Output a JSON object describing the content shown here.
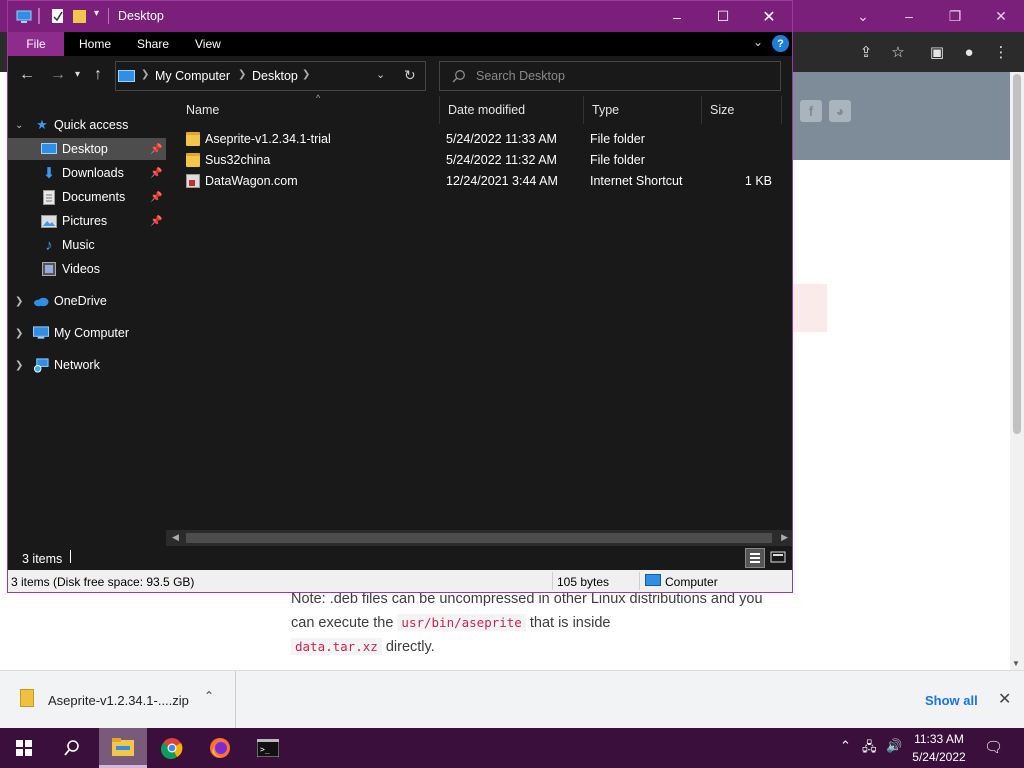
{
  "explorer": {
    "title": "Desktop",
    "ribbon": {
      "file": "File",
      "home": "Home",
      "share": "Share",
      "view": "View"
    },
    "address": {
      "root": "My Computer",
      "current": "Desktop"
    },
    "search_placeholder": "Search Desktop",
    "nav_pane": {
      "quick_access": "Quick access",
      "items": [
        {
          "label": "Desktop",
          "pinned": true,
          "selected": true
        },
        {
          "label": "Downloads",
          "pinned": true
        },
        {
          "label": "Documents",
          "pinned": true
        },
        {
          "label": "Pictures",
          "pinned": true
        },
        {
          "label": "Music"
        },
        {
          "label": "Videos"
        }
      ],
      "roots": [
        "OneDrive",
        "My Computer",
        "Network"
      ]
    },
    "columns": {
      "name": "Name",
      "date": "Date modified",
      "type": "Type",
      "size": "Size"
    },
    "files": [
      {
        "name": "Aseprite-v1.2.34.1-trial",
        "date": "5/24/2022 11:33 AM",
        "type": "File folder",
        "size": "",
        "icon": "folder-icon"
      },
      {
        "name": "Sus32china",
        "date": "5/24/2022 11:32 AM",
        "type": "File folder",
        "size": "",
        "icon": "folder-icon"
      },
      {
        "name": "DataWagon.com",
        "date": "12/24/2021 3:44 AM",
        "type": "Internet Shortcut",
        "size": "1 KB",
        "icon": "shortcut-icon"
      }
    ],
    "status": {
      "items": "3 items"
    },
    "details_bar": {
      "summary": "3 items (Disk free space: 93.5 GB)",
      "size": "105 bytes",
      "location": "Computer"
    }
  },
  "browser_page": {
    "note_part1": "Note: .deb files can be uncompressed in other Linux distributions and you can execute the",
    "note_code1": "usr/bin/aseprite",
    "note_part2": "that is inside",
    "note_code2": "data.tar.xz",
    "note_part3": "directly."
  },
  "download_bar": {
    "file": "Aseprite-v1.2.34.1-....zip",
    "show_all": "Show all"
  },
  "taskbar": {
    "time": "11:33 AM",
    "date": "5/24/2022"
  },
  "colors": {
    "accent": "#7a1f7a",
    "explorer_bg": "#191919",
    "taskbar": "#3a0f3c",
    "link": "#1a73e8"
  }
}
